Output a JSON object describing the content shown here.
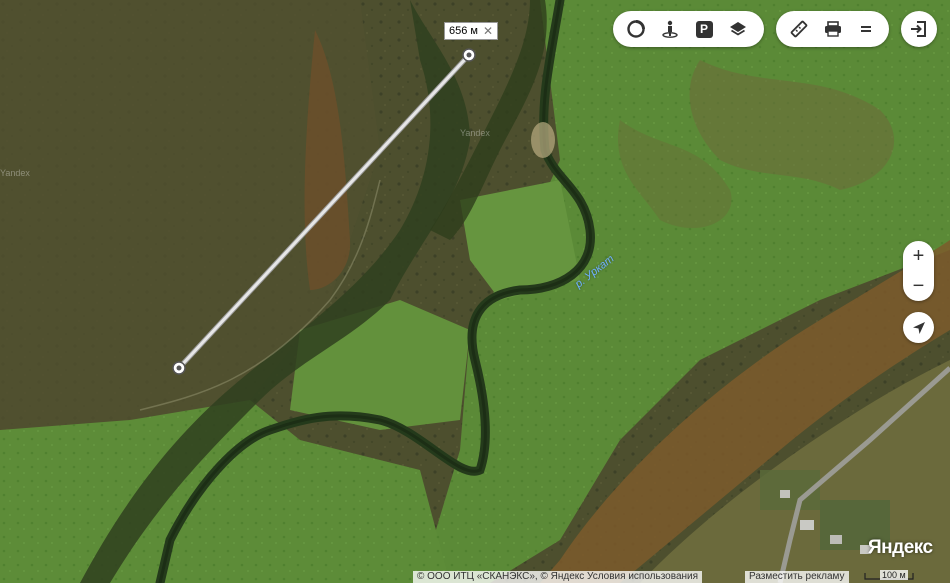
{
  "toolbar_layers": {
    "items": [
      {
        "name": "traffic",
        "icon": "traffic-circle-icon"
      },
      {
        "name": "panorama",
        "icon": "panorama-person-icon"
      },
      {
        "name": "parking",
        "icon": "parking-icon",
        "label": "P"
      },
      {
        "name": "layers",
        "icon": "layers-icon"
      }
    ]
  },
  "toolbar_tools": {
    "items": [
      {
        "name": "ruler",
        "icon": "ruler-icon"
      },
      {
        "name": "print",
        "icon": "printer-icon"
      },
      {
        "name": "menu",
        "icon": "menu-icon"
      }
    ]
  },
  "login": {
    "icon": "login-icon"
  },
  "zoom": {
    "plus": "+",
    "minus": "−"
  },
  "geolocation": {
    "icon": "geolocation-arrow-icon"
  },
  "ruler_measure": {
    "label": "656 м",
    "close": "✕"
  },
  "map_labels": {
    "river": "р. Уркат"
  },
  "watermarks": [
    "Yandex",
    "Yandex"
  ],
  "branding": {
    "logo": "Яндекс"
  },
  "footer": {
    "copyright": "© ООО ИТЦ «СКАНЭКС», © Яндекс",
    "terms": "Условия использования",
    "ads": "Разместить рекламу",
    "scale": "100 м"
  },
  "colors": {
    "field_dark": "#4a4e2c",
    "meadow": "#5a8a36",
    "river": "#27401e",
    "ruler_line": "#d9d9d9",
    "river_label": "#6fb0ff"
  }
}
